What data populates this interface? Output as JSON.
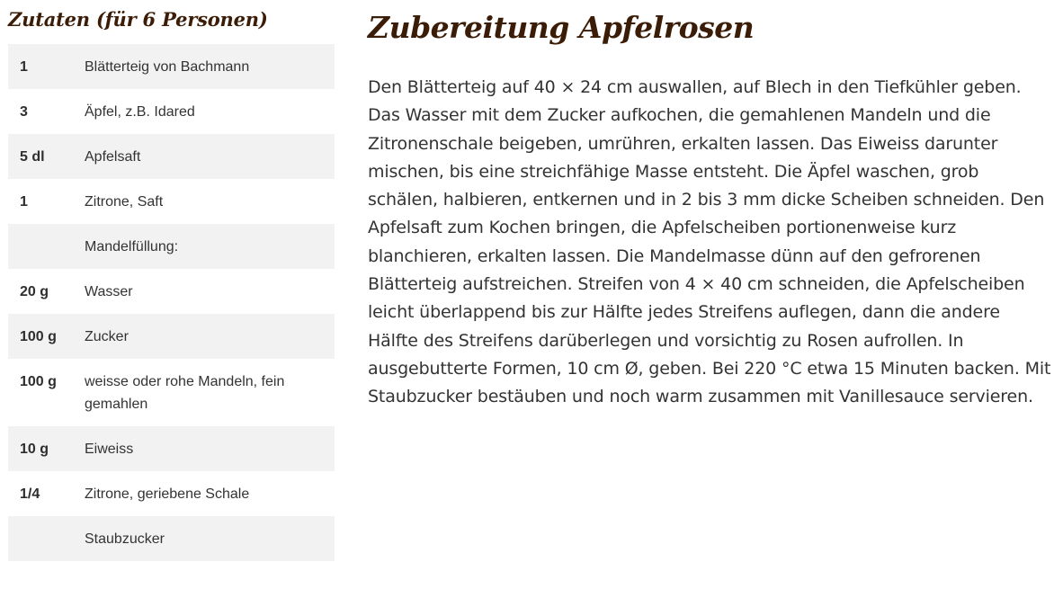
{
  "ingredients": {
    "title": "Zutaten (für 6 Personen)",
    "items": [
      {
        "qty": "1",
        "name": "Blätterteig von Bachmann"
      },
      {
        "qty": "3",
        "name": "Äpfel, z.B. Idared"
      },
      {
        "qty": "5 dl",
        "name": "Apfelsaft"
      },
      {
        "qty": "1",
        "name": "Zitrone, Saft"
      },
      {
        "qty": "",
        "name": "Mandelfüllung:"
      },
      {
        "qty": "20 g",
        "name": "Wasser"
      },
      {
        "qty": "100 g",
        "name": "Zucker"
      },
      {
        "qty": "100 g",
        "name": "weisse oder rohe Mandeln, fein gemahlen"
      },
      {
        "qty": "10 g",
        "name": "Eiweiss"
      },
      {
        "qty": "1/4",
        "name": "Zitrone, geriebene Schale"
      },
      {
        "qty": "",
        "name": "Staubzucker"
      }
    ]
  },
  "preparation": {
    "title": "Zubereitung Apfelrosen",
    "text": "Den Blätterteig auf 40 × 24 cm auswallen, auf Blech in den Tiefkühler geben. Das Wasser mit dem Zucker aufkochen, die gemahlenen Mandeln und die Zitronenschale beigeben, umrühren, erkalten lassen. Das Eiweiss darunter mischen, bis eine streichfähige Masse entsteht. Die Äpfel waschen, grob schälen, halbieren, entkernen und in 2 bis 3 mm dicke Scheiben schneiden. Den Apfelsaft zum Kochen bringen, die Apfelscheiben portionenweise kurz blanchieren, erkalten lassen. Die Mandelmasse dünn auf den gefrorenen Blätterteig aufstreichen. Streifen von 4 × 40 cm schneiden, die Apfelscheiben leicht überlappend bis zur Hälfte jedes Streifens auflegen, dann die andere Hälfte des Streifens darüberlegen und vorsichtig zu Rosen aufrollen. In ausgebutterte Formen, 10 cm Ø, geben. Bei 220 °C etwa 15 Minuten backen. Mit Staubzucker bestäuben und noch warm zusammen mit Vanillesauce servieren."
  },
  "colors": {
    "heading": "#3b1c06",
    "text": "#333333",
    "row_stripe": "#f2f2f2"
  }
}
